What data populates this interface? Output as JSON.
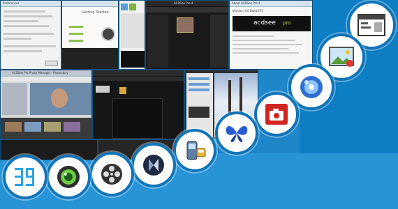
{
  "shots": {
    "top_left_title": "Preferences",
    "dialog_title": "Getting Started",
    "about": {
      "title": "About ACDSee Pro 4",
      "brand": "acdsee",
      "brand_suffix": "pro",
      "version": "Version: 4.0 Build 473"
    },
    "video_title": "ACDSee Pro Photo Manager - Photostory",
    "dark_title": "ACDSee Pro 4"
  },
  "icons": [
    {
      "name": "window-app-icon"
    },
    {
      "name": "photo-viewer-icon"
    },
    {
      "name": "media-player-icon"
    },
    {
      "name": "acrobat-icon"
    },
    {
      "name": "butterfly-icon"
    },
    {
      "name": "mobile-phone-icon"
    },
    {
      "name": "kodi-icon"
    },
    {
      "name": "film-reel-icon"
    },
    {
      "name": "camera-lens-icon"
    },
    {
      "name": "digital-display-icon"
    }
  ],
  "colors": {
    "background": "#1e86c9",
    "circle_ring": "#0f74b8",
    "acrobat_red": "#d0261f"
  }
}
